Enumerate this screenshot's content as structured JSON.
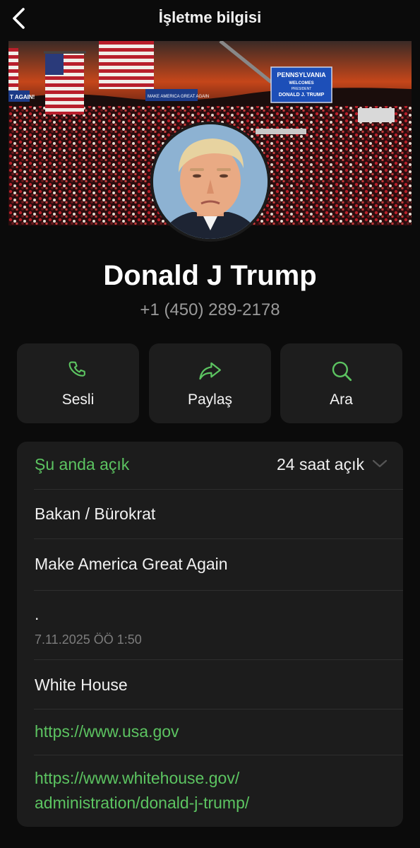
{
  "header": {
    "title": "İşletme bilgisi",
    "back_icon": "chevron-left-icon"
  },
  "cover": {
    "banner_state": "PENNSYLVANIA",
    "banner_welcomes": "WELCOMES",
    "banner_president": "PRESIDENT",
    "banner_name": "DONALD J. TRUMP",
    "sign_left": "MAKE AMERICA GREAT AGAIN",
    "sign_edge": "T AGAIN!"
  },
  "profile": {
    "name": "Donald J Trump",
    "phone": "+1 (450) 289-2178"
  },
  "actions": [
    {
      "label": "Sesli",
      "icon": "phone-icon"
    },
    {
      "label": "Paylaş",
      "icon": "share-icon"
    },
    {
      "label": "Ara",
      "icon": "search-icon"
    }
  ],
  "info": {
    "open_status": "Şu anda açık",
    "hours": "24 saat açık",
    "category": "Bakan / Bürokrat",
    "description": "Make America Great Again",
    "about_text": ".",
    "about_timestamp": "7.11.2025 ÖÖ 1:50",
    "address": "White House",
    "website_1": "https://www.usa.gov",
    "website_2_line1": "https://www.whitehouse.gov/",
    "website_2_line2": "administration/donald-j-trump/"
  },
  "colors": {
    "accent_green": "#5cc461",
    "background": "#0b0b0b",
    "card": "#1c1c1c",
    "secondary_text": "#9a9a9a"
  }
}
